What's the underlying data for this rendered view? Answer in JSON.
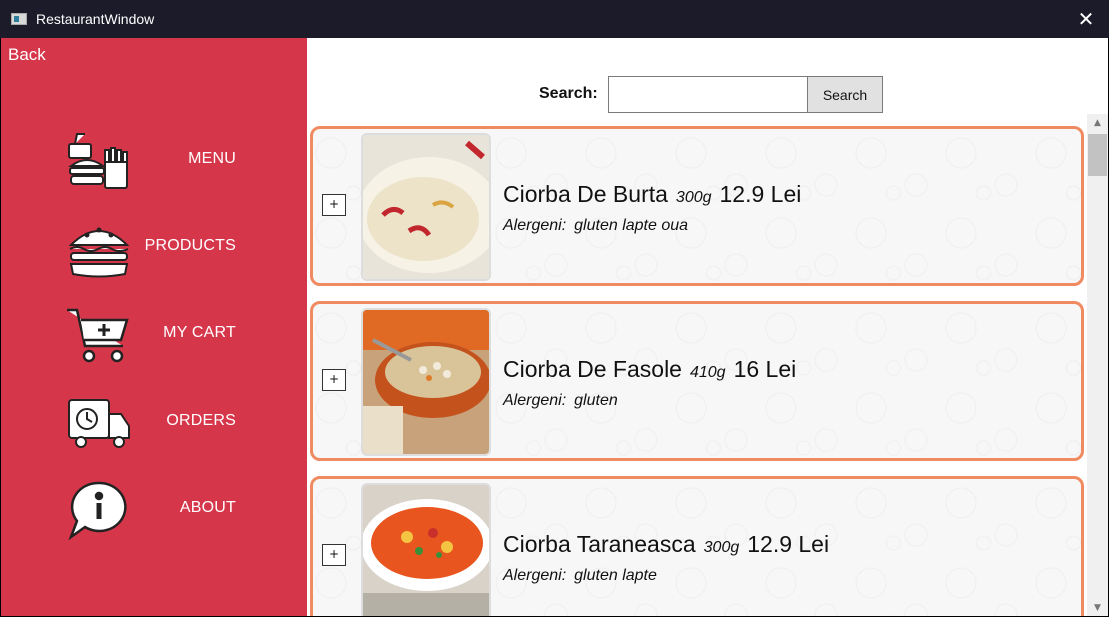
{
  "window": {
    "title": "RestaurantWindow",
    "close_glyph": "✕"
  },
  "sidebar": {
    "back_label": "Back",
    "items": [
      {
        "label": "MENU",
        "icon": "fast-food-icon"
      },
      {
        "label": "PRODUCTS",
        "icon": "burger-icon"
      },
      {
        "label": "MY CART",
        "icon": "cart-icon"
      },
      {
        "label": "ORDERS",
        "icon": "delivery-truck-icon"
      },
      {
        "label": "ABOUT",
        "icon": "info-bubble-icon"
      }
    ],
    "colors": {
      "background": "#d6364a",
      "text": "#ffffff"
    }
  },
  "search": {
    "label": "Search:",
    "value": "",
    "placeholder": "",
    "button_label": "Search"
  },
  "products": [
    {
      "name": "Ciorba De Burta",
      "weight": "300g",
      "price": "12.9 Lei",
      "allergens_label": "Alergeni:",
      "allergens": "gluten lapte oua",
      "add_label": "+"
    },
    {
      "name": "Ciorba De Fasole",
      "weight": "410g",
      "price": "16 Lei",
      "allergens_label": "Alergeni:",
      "allergens": "gluten",
      "add_label": "+"
    },
    {
      "name": "Ciorba Taraneasca",
      "weight": "300g",
      "price": "12.9 Lei",
      "allergens_label": "Alergeni:",
      "allergens": "gluten lapte",
      "add_label": "+"
    }
  ],
  "colors": {
    "card_border": "#f08a60",
    "titlebar": "#1b1b29"
  },
  "scrollbar": {
    "up_glyph": "▲",
    "down_glyph": "▼"
  }
}
